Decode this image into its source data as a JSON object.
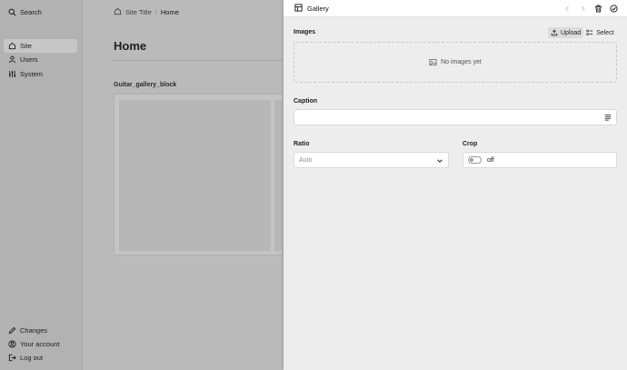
{
  "sidebar": {
    "search_label": "Search",
    "items": [
      {
        "label": "Site",
        "icon": "home-icon"
      },
      {
        "label": "Users",
        "icon": "users-icon"
      },
      {
        "label": "System",
        "icon": "sliders-icon"
      }
    ],
    "footer": [
      {
        "label": "Changes",
        "icon": "pencil-icon"
      },
      {
        "label": "Your account",
        "icon": "account-icon"
      },
      {
        "label": "Log out",
        "icon": "logout-icon"
      }
    ]
  },
  "main": {
    "breadcrumb": [
      "Site Title",
      "Home"
    ],
    "breadcrumb_sep": "/",
    "title": "Home",
    "block_title": "Guitar_gallery_block"
  },
  "drawer": {
    "title": "Gallery",
    "images_label": "Images",
    "upload_label": "Upload",
    "select_label": "Select",
    "empty_text": "No images yet",
    "caption_label": "Caption",
    "caption_value": "",
    "ratio_label": "Ratio",
    "ratio_placeholder": "Auto",
    "crop_label": "Crop",
    "crop_value": "off"
  }
}
